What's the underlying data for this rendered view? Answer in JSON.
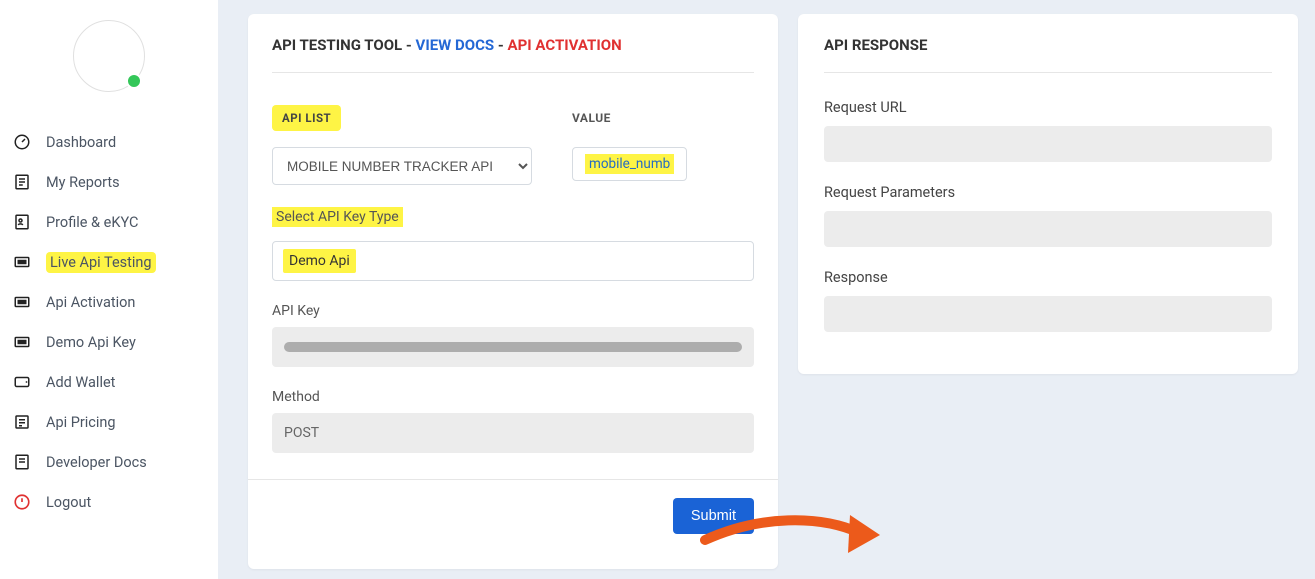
{
  "sidebar": {
    "items": [
      {
        "label": "Dashboard",
        "icon": "gauge"
      },
      {
        "label": "My Reports",
        "icon": "reports"
      },
      {
        "label": "Profile & eKYC",
        "icon": "profile"
      },
      {
        "label": "Live Api Testing",
        "icon": "api",
        "highlight": true
      },
      {
        "label": "Api Activation",
        "icon": "api"
      },
      {
        "label": "Demo Api Key",
        "icon": "api"
      },
      {
        "label": "Add Wallet",
        "icon": "wallet"
      },
      {
        "label": "Api Pricing",
        "icon": "pricing"
      },
      {
        "label": "Developer Docs",
        "icon": "docs"
      },
      {
        "label": "Logout",
        "icon": "power"
      }
    ]
  },
  "tool": {
    "title_prefix": "API TESTING TOOL",
    "view_docs": "VIEW DOCS",
    "api_activation": "API ACTIVATION",
    "sep": " - ",
    "api_list_label": "API LIST",
    "value_label": "VALUE",
    "api_list_selected": "MOBILE NUMBER TRACKER API",
    "value_chip": "mobile_numb",
    "select_key_type_label": "Select API Key Type",
    "key_type_selected": "Demo Api",
    "api_key_label": "API Key",
    "api_key_value": "",
    "method_label": "Method",
    "method_value": "POST",
    "submit_label": "Submit"
  },
  "response": {
    "title": "API RESPONSE",
    "request_url_label": "Request URL",
    "request_params_label": "Request Parameters",
    "response_label": "Response"
  }
}
